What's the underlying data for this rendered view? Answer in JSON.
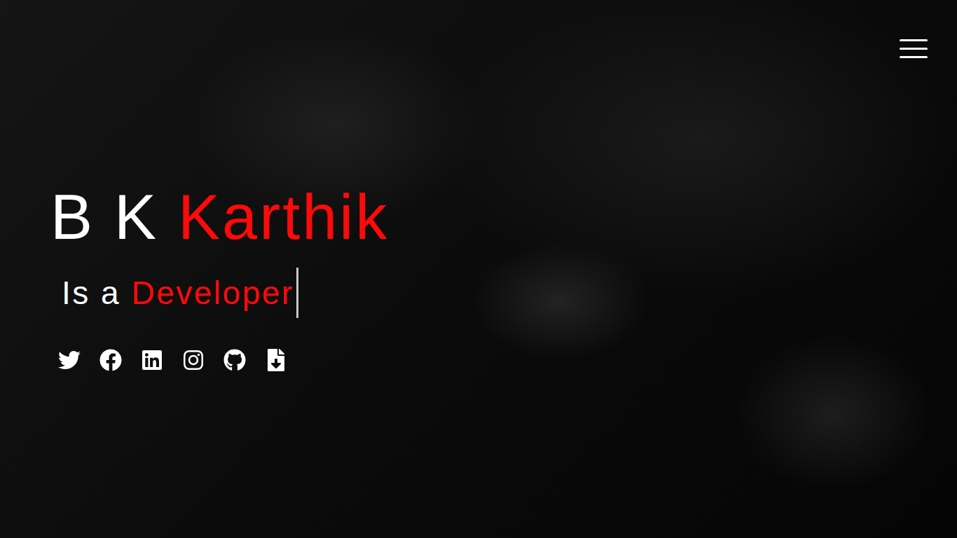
{
  "menu": {
    "expanded": false
  },
  "hero": {
    "name_first": "B K ",
    "name_last": "Karthik"
  },
  "typing": {
    "prefix": "Is a ",
    "word": "Developer",
    "cursor": true
  },
  "socials": [
    {
      "kind": "twitter"
    },
    {
      "kind": "facebook"
    },
    {
      "kind": "linkedin"
    },
    {
      "kind": "instagram"
    },
    {
      "kind": "github"
    },
    {
      "kind": "resume"
    }
  ]
}
